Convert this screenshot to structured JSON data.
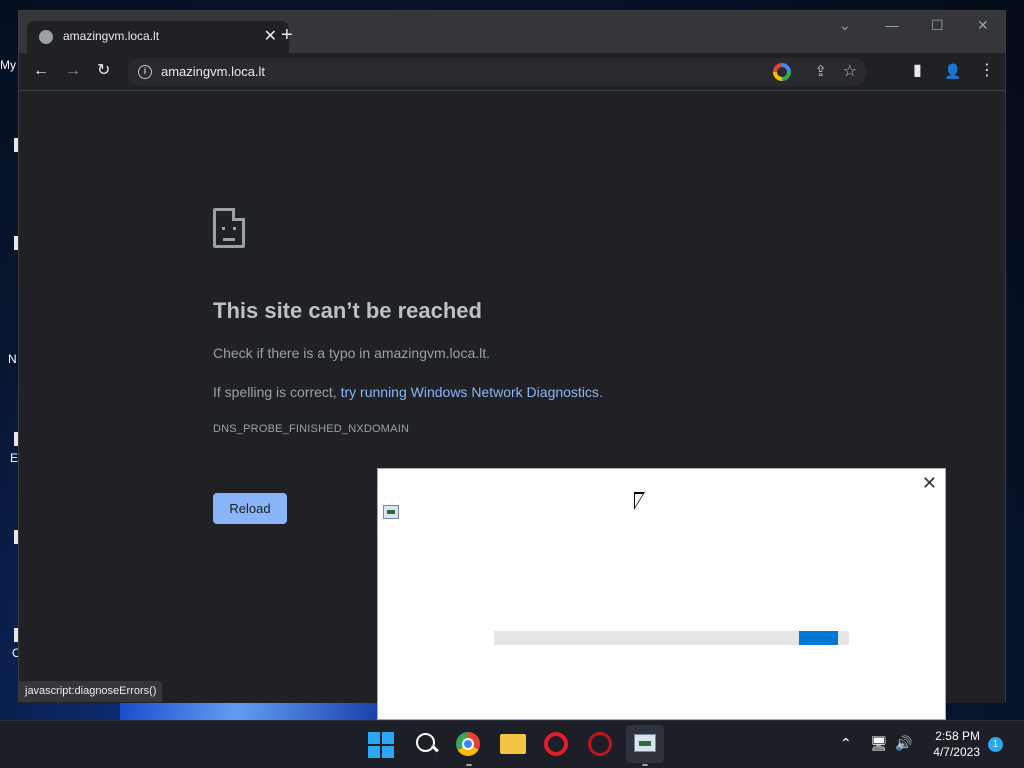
{
  "desktop": {
    "stubs": [
      "My",
      "N",
      "E",
      "C"
    ]
  },
  "browser": {
    "tab_title": "amazingvm.loca.lt",
    "url": "amazingvm.loca.lt",
    "icons": {
      "back": "←",
      "forward": "→",
      "reload": "↻",
      "tab_close": "✕",
      "new_tab": "+",
      "minimize": "—",
      "maximize": "☐",
      "close": "✕",
      "tab_search": "⌄",
      "share": "⇪",
      "bookmark": "☆",
      "sidebar": "▮",
      "profile": "👤",
      "menu": "⋮"
    }
  },
  "error_page": {
    "title": "This site can’t be reached",
    "check_text": "Check if there is a typo in amazingvm.loca.lt.",
    "spelling_prefix": "If spelling is correct, ",
    "diagnostics_link": "try running Windows Network Diagnostics",
    "spelling_suffix": ".",
    "error_code": "DNS_PROBE_FINISHED_NXDOMAIN",
    "reload_label": "Reload",
    "status_bar": "javascript:diagnoseErrors()"
  },
  "dialog": {
    "close_icon": "✕",
    "progress_state": "indeterminate"
  },
  "taskbar": {
    "tray_chevron": "⌃",
    "network_icon": "🖥",
    "volume_icon": "🔊",
    "time": "2:58 PM",
    "date": "4/7/2023",
    "notification_count": "1"
  },
  "colors": {
    "page_bg": "#202124",
    "link": "#8ab4f8",
    "button": "#8ab4f8",
    "progress": "#0078d4",
    "accent": "#29a7f2"
  }
}
